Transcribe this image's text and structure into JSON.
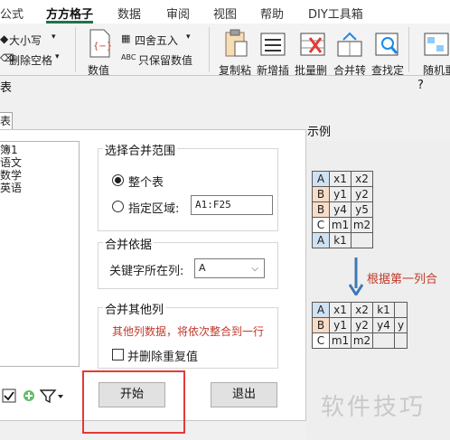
{
  "ribbon": {
    "tabs": [
      "公式",
      "方方格子",
      "数据",
      "审阅",
      "视图",
      "帮助",
      "DIY工具箱"
    ],
    "active_tab": "方方格子",
    "controls": {
      "font_size": "大小写",
      "remove_space": "删除空格",
      "value_label": "数值",
      "round": "四舍五入",
      "keep_value": "只保留数值",
      "abc": "ABC"
    },
    "tools": [
      "复制粘",
      "新增插",
      "批量删",
      "合并转",
      "查找定",
      "随机重"
    ]
  },
  "dialog": {
    "title_fragment": "表",
    "help": "?",
    "tab_fragment": "表",
    "sheets": [
      "簿1",
      "语文",
      "数学",
      "英语"
    ],
    "range_group": {
      "title": "选择合并范围",
      "option_whole": "整个表",
      "option_range": "指定区域:",
      "range_value": "A1:F25",
      "selected": "整个表"
    },
    "basis_group": {
      "title": "合并依据",
      "key_column_label": "关键字所在列:",
      "key_column_value": "A"
    },
    "other_group": {
      "title": "合并其他列",
      "note": "其他列数据，将依次整合到一行",
      "dedupe_label": "并删除重复值",
      "dedupe_checked": false
    },
    "buttons": {
      "start": "开始",
      "exit": "退出"
    },
    "example": {
      "title": "示例",
      "before_rows": [
        [
          "A",
          "x1",
          "x2"
        ],
        [
          "B",
          "y1",
          "y2"
        ],
        [
          "B",
          "y4",
          "y5"
        ],
        [
          "C",
          "m1",
          "m2"
        ],
        [
          "A",
          "k1",
          ""
        ]
      ],
      "merge_label": "根据第一列合",
      "after_rows": [
        [
          "A",
          "x1",
          "x2",
          "k1",
          ""
        ],
        [
          "B",
          "y1",
          "y2",
          "y4",
          "y"
        ],
        [
          "C",
          "m1",
          "m2",
          "",
          ""
        ]
      ],
      "key_colors": {
        "A": "#cfe2f3",
        "B": "#f9dcc6",
        "C": "#ffffff"
      }
    }
  },
  "watermark": "软件技巧"
}
